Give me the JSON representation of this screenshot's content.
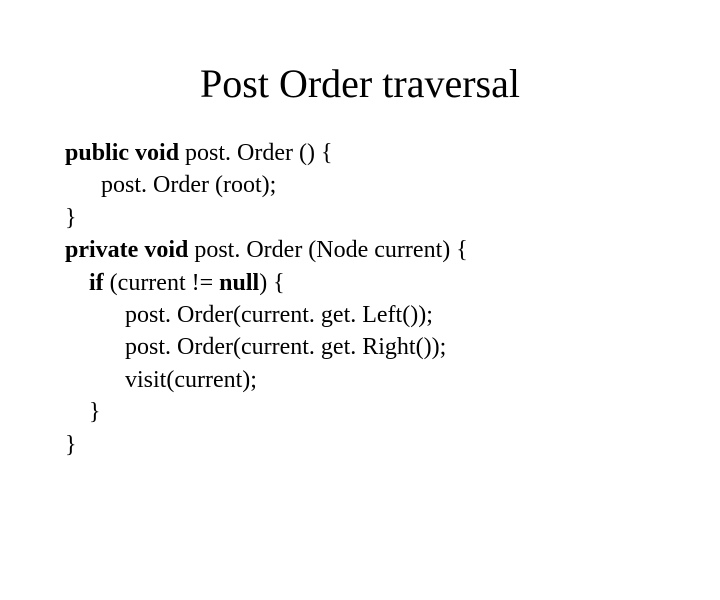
{
  "title": "Post Order traversal",
  "code": {
    "l1_kw": "public void",
    "l1_rest": " post. Order () {",
    "l2": "      post. Order (root);",
    "l3": "}",
    "l4_kw": "private void",
    "l4_rest": " post. Order (Node current) {",
    "l5_pre": "    ",
    "l5_kw": "if",
    "l5_mid": " (current != ",
    "l5_kw2": "null",
    "l5_rest": ") {",
    "l6": "          post. Order(current. get. Left());",
    "l7": "          post. Order(current. get. Right());",
    "l8": "          visit(current);",
    "l9": "    }",
    "l10": "}"
  }
}
